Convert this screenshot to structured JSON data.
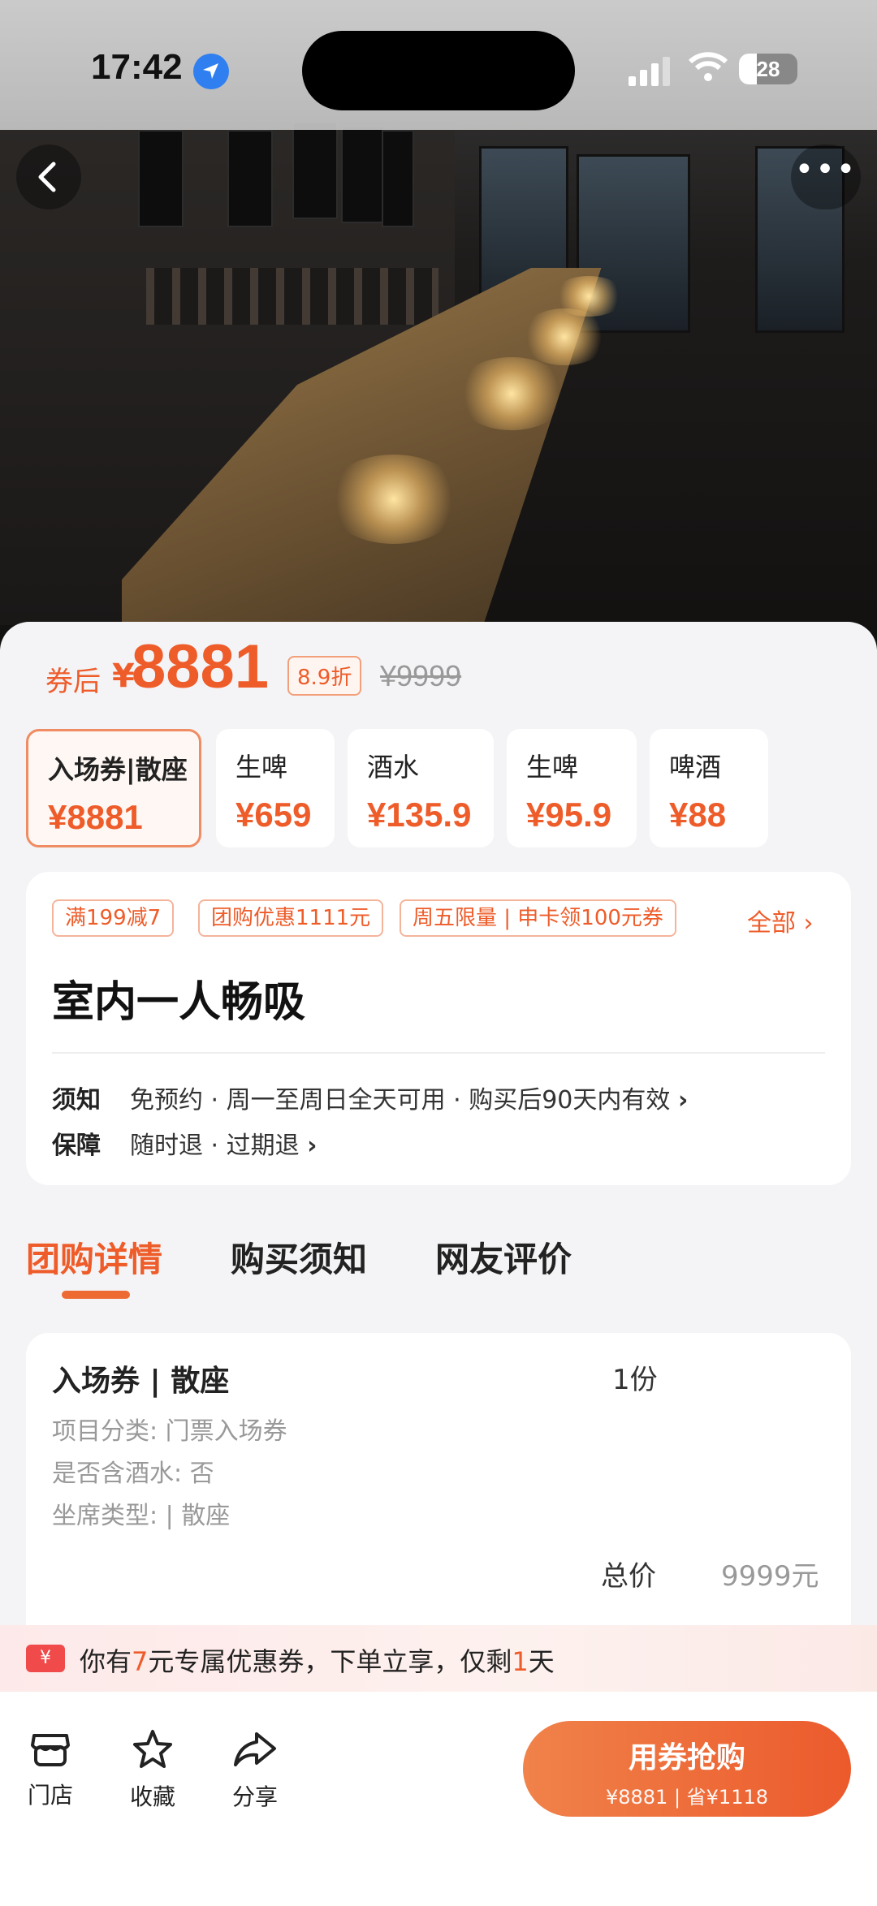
{
  "status_bar": {
    "time": "17:42",
    "battery": "28"
  },
  "price": {
    "label": "券后",
    "currency": "¥",
    "amount": "8881",
    "discount": "8.9折",
    "original": "¥9999"
  },
  "packages": [
    {
      "name": "入场券|散座",
      "price": "¥8881",
      "active": true
    },
    {
      "name": "生啤",
      "price": "¥659"
    },
    {
      "name": "酒水",
      "price": "¥135.9"
    },
    {
      "name": "生啤",
      "price": "¥95.9"
    },
    {
      "name": "啤酒",
      "price": "¥88"
    }
  ],
  "promo_tags": [
    "满199减7",
    "团购优惠1111元",
    "周五限量 | 申卡领100元券"
  ],
  "all_link": "全部",
  "deal_title": "室内一人畅吸",
  "rules": {
    "notice_key": "须知",
    "notice_value": "免预约 · 周一至周日全天可用 · 购买后90天内有效",
    "guarantee_key": "保障",
    "guarantee_value": "随时退 · 过期退"
  },
  "detail_tabs": [
    "团购详情",
    "购买须知",
    "网友评价"
  ],
  "detail": {
    "name": "入场券 | 散座",
    "qty": "1份",
    "lines": [
      "项目分类: 门票入场券",
      "是否含酒水: 否",
      "坐席类型: | 散座"
    ],
    "total_label": "总价",
    "total_value": "9999元"
  },
  "coupon": {
    "icon": "¥",
    "pre": "你有",
    "amount": "7",
    "mid": "元专属优惠券，下单立享，仅剩",
    "days": "1",
    "post": "天"
  },
  "bottom": {
    "store": "门店",
    "favorite": "收藏",
    "share": "分享",
    "cta_main": "用券抢购",
    "cta_sub": "¥8881 | 省¥1118"
  },
  "colors": {
    "accent": "#ee5c2a",
    "coupon_red": "#f04a4a"
  }
}
